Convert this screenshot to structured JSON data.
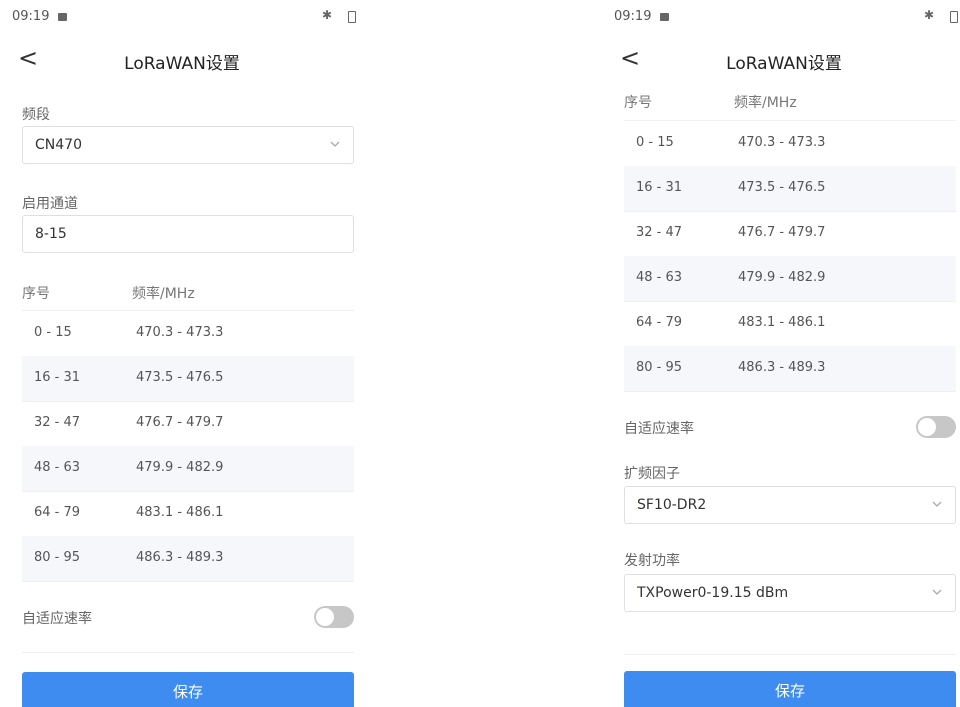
{
  "status": {
    "time": "09:19",
    "bt_icon": "bluetooth-icon",
    "battery_icon": "battery-icon"
  },
  "header": {
    "back_glyph": "<",
    "title": "LoRaWAN设置"
  },
  "form": {
    "band_label": "频段",
    "band_value": "CN470",
    "channels_label": "启用通道",
    "channels_value": "8-15",
    "table_headers": {
      "index": "序号",
      "freq": "频率/MHz"
    },
    "table_rows": [
      {
        "index": "0 - 15",
        "freq": "470.3 - 473.3"
      },
      {
        "index": "16 - 31",
        "freq": "473.5 - 476.5"
      },
      {
        "index": "32 - 47",
        "freq": "476.7 - 479.7"
      },
      {
        "index": "48 - 63",
        "freq": "479.9 - 482.9"
      },
      {
        "index": "64 - 79",
        "freq": "483.1 - 486.1"
      },
      {
        "index": "80 - 95",
        "freq": "486.3 - 489.3"
      }
    ],
    "adr_label": "自适应速率",
    "adr_enabled": false,
    "sf_label": "扩频因子",
    "sf_value": "SF10-DR2",
    "txpower_label": "发射功率",
    "txpower_value": "TXPower0-19.15 dBm"
  },
  "footer": {
    "save_label": "保存"
  },
  "colors": {
    "accent": "#3e8cf0",
    "row_alt": "#f5f7fa",
    "toggle_off": "#c7c7c7"
  }
}
